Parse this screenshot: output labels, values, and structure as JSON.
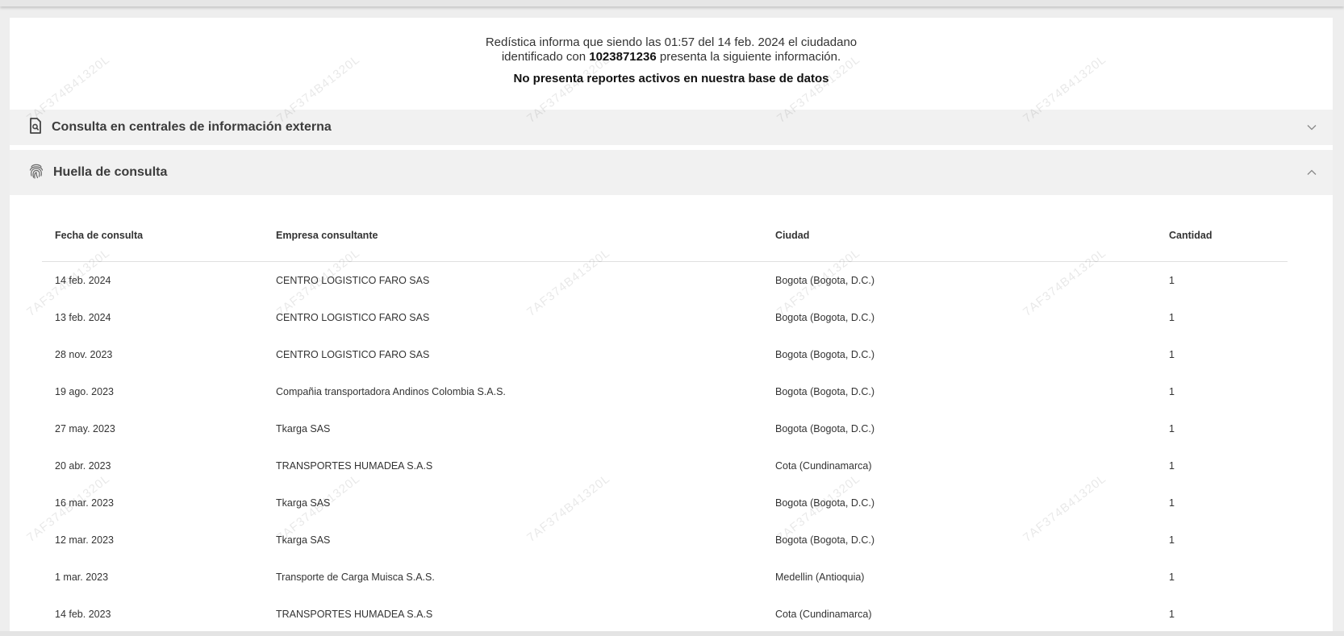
{
  "intro": {
    "prefix": "Redística informa que siendo las 01:57 del 14 feb. 2024 el ciudadano",
    "id_prefix": "identificado con ",
    "id_number": "1023871236",
    "id_suffix": " presenta la siguiente información.",
    "status": "No presenta reportes activos en nuestra base de datos"
  },
  "sections": {
    "external": {
      "title": "Consulta en centrales de información externa",
      "icon": "document-search-icon",
      "expanded": false
    },
    "fingerprint": {
      "title": "Huella de consulta",
      "icon": "fingerprint-icon",
      "expanded": true
    }
  },
  "table": {
    "headers": [
      "Fecha de consulta",
      "Empresa consultante",
      "Ciudad",
      "Cantidad"
    ],
    "rows": [
      [
        "14 feb. 2024",
        "CENTRO LOGISTICO FARO SAS",
        "Bogota (Bogota, D.C.)",
        "1"
      ],
      [
        "13 feb. 2024",
        "CENTRO LOGISTICO FARO SAS",
        "Bogota (Bogota, D.C.)",
        "1"
      ],
      [
        "28 nov. 2023",
        "CENTRO LOGISTICO FARO SAS",
        "Bogota (Bogota, D.C.)",
        "1"
      ],
      [
        "19 ago. 2023",
        "Compañia transportadora Andinos Colombia S.A.S.",
        "Bogota (Bogota, D.C.)",
        "1"
      ],
      [
        "27 may. 2023",
        "Tkarga SAS",
        "Bogota (Bogota, D.C.)",
        "1"
      ],
      [
        "20 abr. 2023",
        "TRANSPORTES HUMADEA S.A.S",
        "Cota (Cundinamarca)",
        "1"
      ],
      [
        "16 mar. 2023",
        "Tkarga SAS",
        "Bogota (Bogota, D.C.)",
        "1"
      ],
      [
        "12 mar. 2023",
        "Tkarga SAS",
        "Bogota (Bogota, D.C.)",
        "1"
      ],
      [
        "1 mar. 2023",
        "Transporte de Carga Muisca S.A.S.",
        "Medellin (Antioquia)",
        "1"
      ],
      [
        "14 feb. 2023",
        "TRANSPORTES HUMADEA S.A.S",
        "Cota (Cundinamarca)",
        "1"
      ]
    ]
  },
  "watermark": "7AF374B41320L"
}
